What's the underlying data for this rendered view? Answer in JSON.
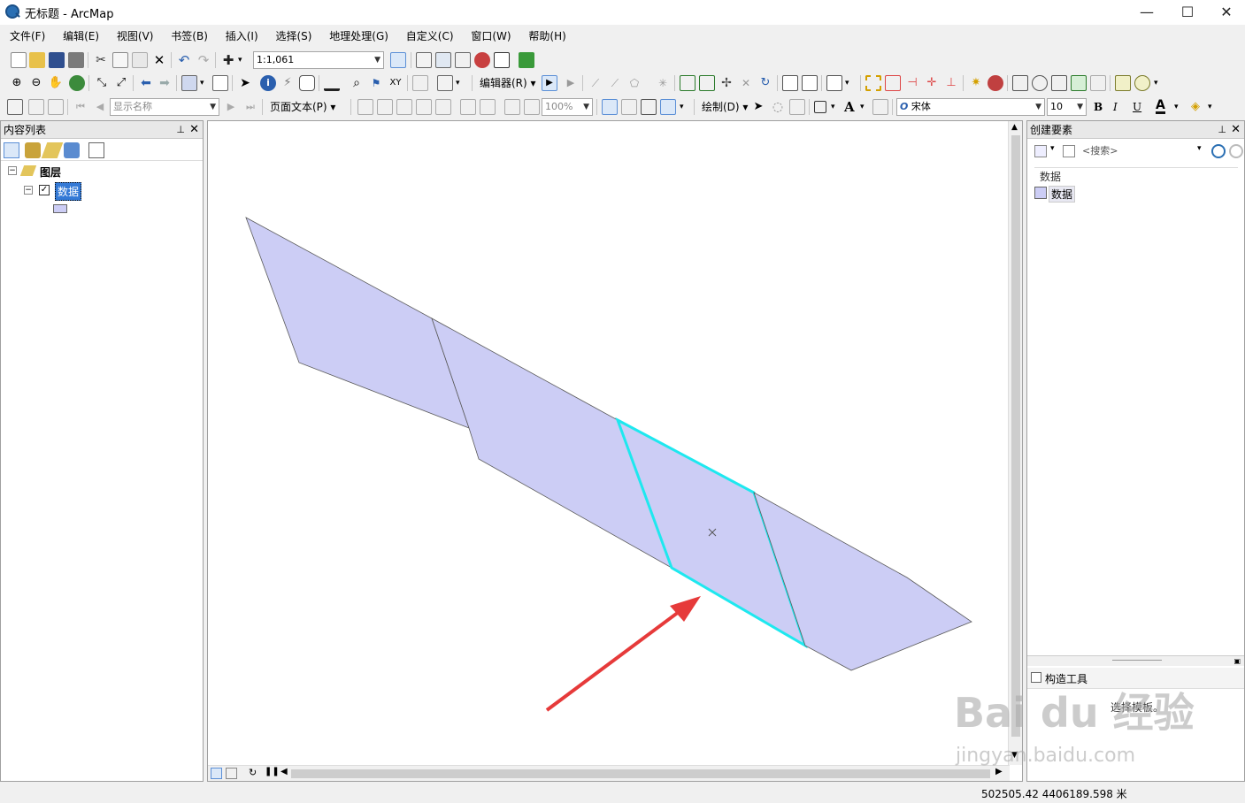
{
  "window": {
    "title": "无标题 - ArcMap"
  },
  "menu": [
    "文件(F)",
    "编辑(E)",
    "视图(V)",
    "书签(B)",
    "插入(I)",
    "选择(S)",
    "地理处理(G)",
    "自定义(C)",
    "窗口(W)",
    "帮助(H)"
  ],
  "toolbar": {
    "scale": "1:1,061",
    "editor_label": "编辑器(R)",
    "display_name_placeholder": "显示名称",
    "page_text_label": "页面文本(P)",
    "zoom_percent": "100%",
    "draw_label": "绘制(D)",
    "font_name": "宋体",
    "font_size": "10",
    "bold": "B",
    "italic": "I",
    "underline": "U",
    "font_color_glyph": "A"
  },
  "toc": {
    "title": "内容列表",
    "root_label": "图层",
    "layer_name": "数据",
    "layer_checked": true,
    "symbol_color": "#cccdf5"
  },
  "create_features": {
    "title": "创建要素",
    "search_placeholder": "<搜索>",
    "group_label": "数据",
    "template_label": "数据",
    "construct_tools_title": "构造工具",
    "select_template_hint": "选择模板。"
  },
  "map": {
    "fill_color": "#cccdf5",
    "outline_color": "#5a5a5a",
    "selection_color": "#1ee8ef",
    "arrow_color": "#e63a3a"
  },
  "status": {
    "coordinates": "502505.42  4406189.598 米"
  },
  "watermark": {
    "brand": "Bai du 经验",
    "url": "jingyan.baidu.com"
  }
}
